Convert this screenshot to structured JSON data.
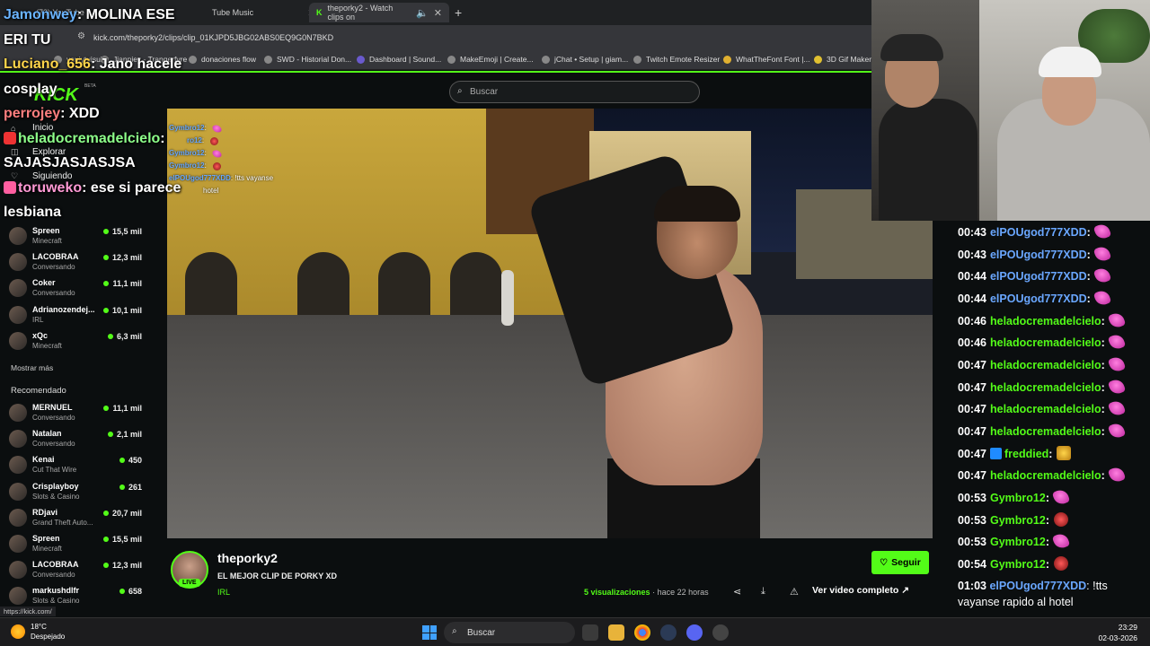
{
  "browser": {
    "tabs": [
      {
        "label": "(73) YouTube"
      },
      {
        "label": "Tube Music"
      },
      {
        "label": "theporky2 - Watch clips on"
      }
    ],
    "url": "kick.com/theporky2/clips/clip_01KJPD5JBG02ABS0EQ9G0N7BKD",
    "bookmarks": [
      "yauiytuisuiar",
      "Jianpiey - Trangerfyre",
      "donaciones flow",
      "SWD - Historial Don...",
      "Dashboard | Sound...",
      "MakeEmoji | Create...",
      "jChat • Setup | giam...",
      "Twitch Emote Resizer",
      "WhatTheFont Font |...",
      "3D Gif Maker"
    ]
  },
  "kick": {
    "logo": "KICK",
    "beta": "BETA",
    "search_placeholder": "Buscar",
    "nav": [
      {
        "label": "Inicio",
        "icon": "home-icon"
      },
      {
        "label": "Explorar",
        "icon": "compass-icon"
      },
      {
        "label": "Siguiendo",
        "icon": "heart-icon"
      }
    ],
    "following": [
      {
        "name": "Spreen",
        "category": "Minecraft",
        "viewers": "15,5 mil"
      },
      {
        "name": "LACOBRAA",
        "category": "Conversando",
        "viewers": "12,3 mil"
      },
      {
        "name": "Coker",
        "category": "Conversando",
        "viewers": "11,1 mil"
      },
      {
        "name": "Adrianozendej...",
        "category": "IRL",
        "viewers": "10,1 mil"
      },
      {
        "name": "xQc",
        "category": "Minecraft",
        "viewers": "6,3 mil"
      }
    ],
    "show_more": "Mostrar más",
    "recommended_title": "Recomendado",
    "recommended": [
      {
        "name": "MERNUEL",
        "category": "Conversando",
        "viewers": "11,1 mil"
      },
      {
        "name": "Natalan",
        "category": "Conversando",
        "viewers": "2,1 mil"
      },
      {
        "name": "Kenai",
        "category": "Cut That Wire",
        "viewers": "450"
      },
      {
        "name": "Crisplayboy",
        "category": "Slots & Casino",
        "viewers": "261"
      },
      {
        "name": "RDjavi",
        "category": "Grand Theft Auto...",
        "viewers": "20,7 mil"
      },
      {
        "name": "Spreen",
        "category": "Minecraft",
        "viewers": "15,5 mil"
      },
      {
        "name": "LACOBRAA",
        "category": "Conversando",
        "viewers": "12,3 mil"
      },
      {
        "name": "markushdlfr",
        "category": "Slots & Casino",
        "viewers": "658"
      }
    ],
    "status_url": "https://kick.com/"
  },
  "clip_chat": [
    {
      "user": "Gymbro12",
      "text": ""
    },
    {
      "user": "ro12",
      "text": ""
    },
    {
      "user": "Gymbro12",
      "text": ""
    },
    {
      "user": "Gymbro12",
      "text": ""
    },
    {
      "user": "elPOUgod777XDD",
      "text": "!tts vayanse"
    },
    {
      "user": "",
      "text": "hotel"
    }
  ],
  "overlay_chat": [
    {
      "user": "Jamonwey",
      "text": "MOLINA ESE"
    },
    {
      "user": "",
      "text": "ERI TU"
    },
    {
      "user": "Luciano_656",
      "text": "Jano hacele"
    },
    {
      "user": "",
      "text": "cosplay"
    },
    {
      "user": "perrojey",
      "text": "XDD"
    },
    {
      "user": "heladocremadelcielo",
      "text": ""
    },
    {
      "user": "",
      "text": "SAJASJASJASJSA"
    },
    {
      "user": "toruweko",
      "text": "ese si parece"
    },
    {
      "user": "",
      "text": "lesbiana"
    }
  ],
  "clip_info": {
    "channel": "theporky2",
    "live_badge": "LIVE",
    "title": "EL MEJOR CLIP DE PORKY XD",
    "category": "IRL",
    "follow_label": "Seguir",
    "views_count": "5",
    "views_label": "visualizaciones",
    "time": "· hace 22 horas",
    "full_video": "Ver video completo"
  },
  "chat": [
    {
      "time": "00:43",
      "user": "elPOUgod777XDD",
      "emote": "pink",
      "style": "a"
    },
    {
      "time": "00:43",
      "user": "elPOUgod777XDD",
      "emote": "pink",
      "style": "a"
    },
    {
      "time": "00:44",
      "user": "elPOUgod777XDD",
      "emote": "pink",
      "style": "a"
    },
    {
      "time": "00:44",
      "user": "elPOUgod777XDD",
      "emote": "pink",
      "style": "a"
    },
    {
      "time": "00:46",
      "user": "heladocremadelcielo",
      "emote": "pink",
      "style": "b"
    },
    {
      "time": "00:46",
      "user": "heladocremadelcielo",
      "emote": "pink",
      "style": "b"
    },
    {
      "time": "00:47",
      "user": "heladocremadelcielo",
      "emote": "pink",
      "style": "b"
    },
    {
      "time": "00:47",
      "user": "heladocremadelcielo",
      "emote": "pink",
      "style": "b"
    },
    {
      "time": "00:47",
      "user": "heladocremadelcielo",
      "emote": "pink",
      "style": "b"
    },
    {
      "time": "00:47",
      "user": "heladocremadelcielo",
      "emote": "pink",
      "style": "b"
    },
    {
      "time": "00:47",
      "user": "freddied",
      "emote": "gold",
      "style": "c"
    },
    {
      "time": "00:47",
      "user": "heladocremadelcielo",
      "emote": "pink",
      "style": "b"
    },
    {
      "time": "00:53",
      "user": "Gymbro12",
      "emote": "pink",
      "style": "b"
    },
    {
      "time": "00:53",
      "user": "Gymbro12",
      "emote": "red",
      "style": "b"
    },
    {
      "time": "00:53",
      "user": "Gymbro12",
      "emote": "pink",
      "style": "b"
    },
    {
      "time": "00:54",
      "user": "Gymbro12",
      "emote": "red",
      "style": "b"
    }
  ],
  "chat_last": {
    "time": "01:03",
    "user": "elPOUgod777XDD",
    "text": "!tts vayanse rapido al hotel"
  },
  "taskbar": {
    "temp": "18°C",
    "weather": "Despejado",
    "search": "Buscar",
    "time": "23:29",
    "date": "02-03-2026"
  },
  "colors": {
    "accent": "#53fc18",
    "chat_blue": "#6aa7ff"
  }
}
